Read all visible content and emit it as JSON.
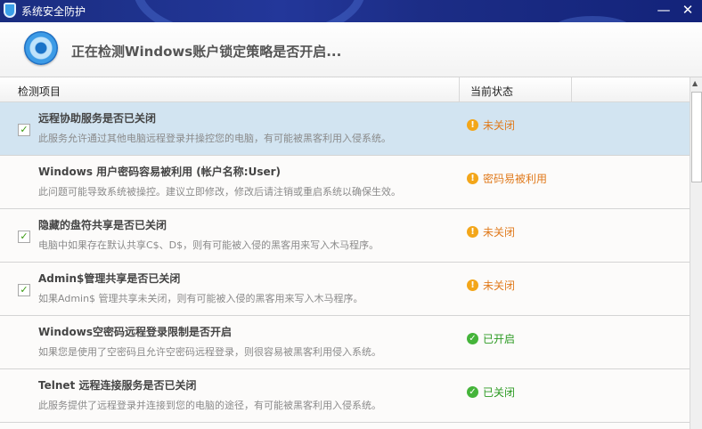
{
  "window": {
    "title": "系统安全防护",
    "minimize": "—",
    "close": "✕"
  },
  "header": {
    "status_text": "正在检测Windows账户锁定策略是否开启..."
  },
  "columns": {
    "item": "检测项目",
    "status": "当前状态"
  },
  "rows": [
    {
      "title": "远程协助服务是否已关闭",
      "desc": "此服务允许通过其他电脑远程登录并操控您的电脑，有可能被黑客利用入侵系统。",
      "status": "未关闭",
      "level": "warn",
      "checkbox": true,
      "checked": true,
      "selected": true
    },
    {
      "title": "Windows 用户密码容易被利用 (帐户名称:User)",
      "desc": "此问题可能导致系统被操控。建议立即修改，修改后请注销或重启系统以确保生效。",
      "status": "密码易被利用",
      "level": "warn",
      "checkbox": false,
      "checked": false,
      "selected": false
    },
    {
      "title": "隐藏的盘符共享是否已关闭",
      "desc": "电脑中如果存在默认共享C$、D$，则有可能被入侵的黑客用来写入木马程序。",
      "status": "未关闭",
      "level": "warn",
      "checkbox": true,
      "checked": true,
      "selected": false
    },
    {
      "title": "Admin$管理共享是否已关闭",
      "desc": "如果Admin$ 管理共享未关闭，则有可能被入侵的黑客用来写入木马程序。",
      "status": "未关闭",
      "level": "warn",
      "checkbox": true,
      "checked": true,
      "selected": false
    },
    {
      "title": "Windows空密码远程登录限制是否开启",
      "desc": "如果您是使用了空密码且允许空密码远程登录，则很容易被黑客利用侵入系统。",
      "status": "已开启",
      "level": "ok",
      "checkbox": false,
      "checked": false,
      "selected": false
    },
    {
      "title": "Telnet 远程连接服务是否已关闭",
      "desc": "此服务提供了远程登录并连接到您的电脑的途径，有可能被黑客利用入侵系统。",
      "status": "已关闭",
      "level": "ok",
      "checkbox": false,
      "checked": false,
      "selected": false
    }
  ],
  "icons": {
    "warn": "!",
    "ok": "✓",
    "check": "✓"
  }
}
